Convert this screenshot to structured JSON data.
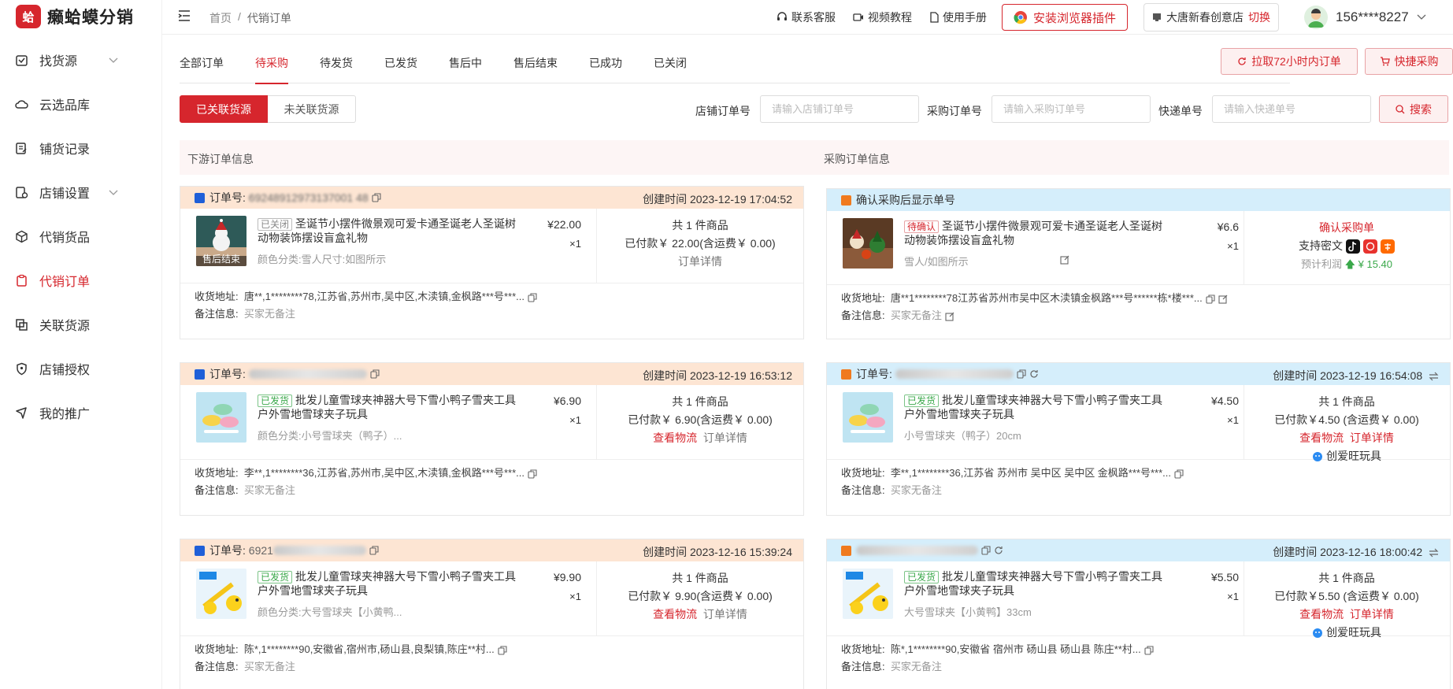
{
  "app": {
    "logo_text": "癞蛤蟆分销",
    "logo_mark": "蛤"
  },
  "header": {
    "breadcrumb_home": "首页",
    "breadcrumb_sep": "/",
    "breadcrumb_current": "代销订单",
    "links": [
      {
        "label": "联系客服",
        "icon": "headset-icon"
      },
      {
        "label": "视频教程",
        "icon": "video-icon"
      },
      {
        "label": "使用手册",
        "icon": "document-icon"
      }
    ],
    "plugin_button": "安装浏览器插件",
    "shop_name": "大唐新春创意店",
    "shop_switch": "切换",
    "user_phone": "156****8227"
  },
  "sidebar": {
    "items": [
      {
        "label": "找货源",
        "icon": "box-icon",
        "has_children": true
      },
      {
        "label": "云选品库",
        "icon": "cloud-icon",
        "has_children": false
      },
      {
        "label": "铺货记录",
        "icon": "record-icon",
        "has_children": false
      },
      {
        "label": "店铺设置",
        "icon": "store-settings-icon",
        "has_children": true
      },
      {
        "label": "代销货品",
        "icon": "package-icon",
        "has_children": false
      },
      {
        "label": "代销订单",
        "icon": "clipboard-icon",
        "has_children": false,
        "active": true
      },
      {
        "label": "关联货源",
        "icon": "link-icon",
        "has_children": false
      },
      {
        "label": "店铺授权",
        "icon": "shield-icon",
        "has_children": false
      },
      {
        "label": "我的推广",
        "icon": "megaphone-icon",
        "has_children": false
      }
    ]
  },
  "tabs": [
    "全部订单",
    "待采购",
    "待发货",
    "已发货",
    "售后中",
    "售后结束",
    "已成功",
    "已关闭"
  ],
  "active_tab": "待采购",
  "actions": {
    "pull_72h": "拉取72小时内订单",
    "quick_purchase": "快捷采购"
  },
  "filters": {
    "linked": "已关联货源",
    "unlinked": "未关联货源",
    "shop_order_label": "店铺订单号",
    "shop_order_placeholder": "请输入店铺订单号",
    "purchase_order_label": "采购订单号",
    "purchase_order_placeholder": "请输入采购订单号",
    "express_label": "快递单号",
    "express_placeholder": "请输入快递单号",
    "search_label": "搜索"
  },
  "columns": {
    "left": "下游订单信息",
    "right": "采购订单信息"
  },
  "labels": {
    "order_no": "订单号:",
    "created": "创建时间",
    "total_prefix": "共 1 件商品",
    "address_label": "收货地址:",
    "remark_label": "备注信息:",
    "remark_value": "买家无备注",
    "order_detail": "订单详情",
    "view_logistics": "查看物流",
    "confirm_show": "确认采购后显示单号",
    "confirm_purchase": "确认采购单",
    "support_cipher": "支持密文",
    "est_profit": "预计利润",
    "supplier": "创爱旺玩具"
  },
  "orders": [
    {
      "left": {
        "order_no": "69248912973137001 48",
        "created": "创建时间 2023-12-19 17:04:52",
        "status": "已关闭",
        "title": "圣诞节小摆件微景观可爱卡通圣诞老人圣诞树动物装饰摆设盲盒礼物",
        "spec": "颜色分类:雪人尺寸:如图所示",
        "price": "¥22.00",
        "qty": "×1",
        "total": "共 1 件商品",
        "paid": "已付款￥ 22.00(含运费￥ 0.00)",
        "links": [
          "订单详情"
        ],
        "thumb_badge": "售后结束",
        "address": "唐**,1********78,江苏省,苏州市,吴中区,木渎镇,金枫路***号***..."
      },
      "right": {
        "header": "确认采购后显示单号",
        "status": "待确认",
        "title": "圣诞节小摆件微景观可爱卡通圣诞老人圣诞树动物装饰摆设盲盒礼物",
        "spec": "雪人/如图所示",
        "price": "¥6.6",
        "qty": "×1",
        "confirm": "确认采购单",
        "support": "支持密文",
        "profit": "预计利润",
        "profit_value": "¥ 15.40",
        "address": "唐**1********78江苏省苏州市吴中区木渎镇金枫路***号******栋*楼***..."
      }
    },
    {
      "left": {
        "order_no": "",
        "created": "创建时间 2023-12-19 16:53:12",
        "status": "已发货",
        "title": "批发儿童雪球夹神器大号下雪小鸭子雪夹工具户外雪地雪球夹子玩具",
        "spec": "颜色分类:小号雪球夹（鸭子）...",
        "price": "¥6.90",
        "qty": "×1",
        "total": "共 1 件商品",
        "paid": "已付款￥ 6.90(含运费￥ 0.00)",
        "links": [
          "查看物流",
          "订单详情"
        ],
        "address": "李**,1********36,江苏省,苏州市,吴中区,木渎镇,金枫路***号***..."
      },
      "right": {
        "order_no": "",
        "created": "创建时间 2023-12-19 16:54:08",
        "status": "已发货",
        "title": "批发儿童雪球夹神器大号下雪小鸭子雪夹工具户外雪地雪球夹子玩具",
        "spec": "小号雪球夹（鸭子）20cm",
        "price": "¥4.50",
        "qty": "×1",
        "total": "共 1 件商品",
        "paid": "已付款￥4.50 (含运费￥ 0.00)",
        "links": [
          "查看物流",
          "订单详情"
        ],
        "supplier": "创爱旺玩具",
        "address": "李**,1********36,江苏省 苏州市 吴中区 吴中区 金枫路***号***..."
      }
    },
    {
      "left": {
        "order_no": "6921",
        "created": "创建时间 2023-12-16 15:39:24",
        "status": "已发货",
        "title": "批发儿童雪球夹神器大号下雪小鸭子雪夹工具户外雪地雪球夹子玩具",
        "spec": "颜色分类:大号雪球夹【小黄鸭...",
        "price": "¥9.90",
        "qty": "×1",
        "total": "共 1 件商品",
        "paid": "已付款￥ 9.90(含运费￥ 0.00)",
        "links": [
          "查看物流",
          "订单详情"
        ],
        "address": "陈*,1********90,安徽省,宿州市,砀山县,良梨镇,陈庄**村..."
      },
      "right": {
        "order_no": "",
        "created": "创建时间 2023-12-16 18:00:42",
        "status": "已发货",
        "title": "批发儿童雪球夹神器大号下雪小鸭子雪夹工具户外雪地雪球夹子玩具",
        "spec": "大号雪球夹【小黄鸭】33cm",
        "price": "¥5.50",
        "qty": "×1",
        "total": "共 1 件商品",
        "paid": "已付款￥5.50 (含运费￥ 0.00)",
        "links": [
          "查看物流",
          "订单详情"
        ],
        "supplier": "创爱旺玩具",
        "address": "陈*,1********90,安徽省 宿州市 砀山县 砀山县 陈庄**村..."
      }
    }
  ],
  "colors": {
    "accent": "#d6262d",
    "left_head": "#fde5d3",
    "right_head": "#d5eefb",
    "profit": "#3aa84a",
    "status_green": "#3aa84a"
  }
}
